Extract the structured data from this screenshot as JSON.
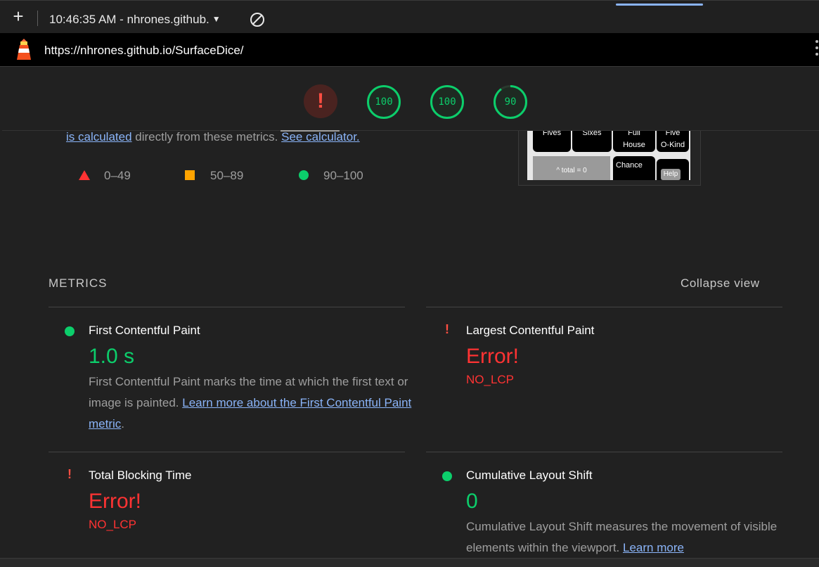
{
  "toolbar": {
    "report_label": "10:46:35 AM - nhrones.github.",
    "add_icon": "plus-icon",
    "clear_icon": "circle-slash-icon"
  },
  "urlbar": {
    "url": "https://nhrones.github.io/SurfaceDice/"
  },
  "gauges": [
    {
      "type": "error",
      "label": "!"
    },
    {
      "value": "100",
      "score": 100
    },
    {
      "value": "100",
      "score": 100
    },
    {
      "value": "90",
      "score": 90
    }
  ],
  "calc": {
    "link1": "is calculated",
    "text": " directly from these metrics. ",
    "link2": "See calculator."
  },
  "legend": [
    {
      "range": "0–49",
      "color": "#ff3333"
    },
    {
      "range": "50–89",
      "color": "#ffa400"
    },
    {
      "range": "90–100",
      "color": "#0cce6b"
    }
  ],
  "thumbnail": {
    "fives": "Fives",
    "sixes": "Sixes",
    "full": "Full",
    "house": "House",
    "five": "Five",
    "okind": "O-Kind",
    "total": "^ total = 0",
    "chance": "Chance",
    "help": "Help"
  },
  "metrics": {
    "title": "METRICS",
    "collapse": "Collapse view",
    "fcp": {
      "name": "First Contentful Paint",
      "value": "1.0 s",
      "desc": "First Contentful Paint marks the time at which the first text or image is painted. ",
      "link": "Learn more about the First Contentful Paint metric",
      "tail": "."
    },
    "lcp": {
      "name": "Largest Contentful Paint",
      "value": "Error!",
      "error": "NO_LCP"
    },
    "tbt": {
      "name": "Total Blocking Time",
      "value": "Error!",
      "error": "NO_LCP"
    },
    "cls": {
      "name": "Cumulative Layout Shift",
      "value": "0",
      "desc": "Cumulative Layout Shift measures the movement of visible elements within the viewport. ",
      "link": "Learn more"
    }
  },
  "colors": {
    "pass": "#0cce6b",
    "fail": "#ff3333",
    "average": "#ffa400",
    "link": "#8ab4f8"
  }
}
